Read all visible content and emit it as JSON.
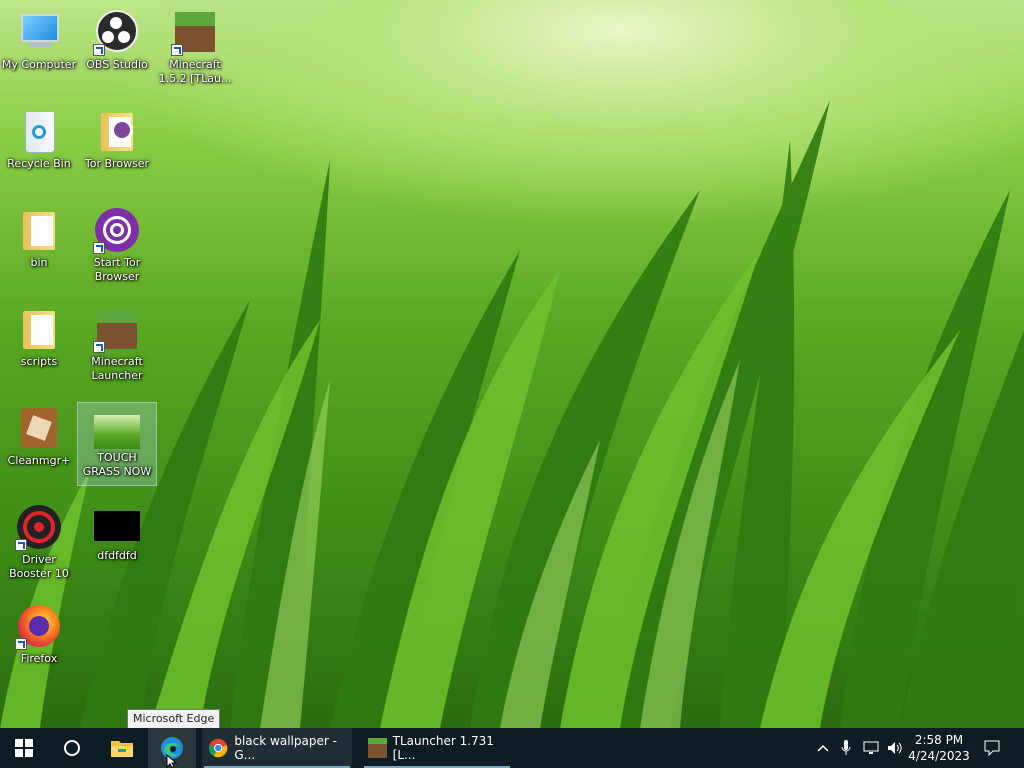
{
  "desktop": {
    "icons": [
      {
        "label": "My Computer",
        "icon": "computer-icon"
      },
      {
        "label": "OBS Studio",
        "icon": "obs-icon"
      },
      {
        "label": "Minecraft 1.5.2 [TLau...",
        "icon": "minecraft-icon"
      },
      {
        "label": "Recycle Bin",
        "icon": "recycle-bin-icon"
      },
      {
        "label": "Tor Browser",
        "icon": "folder-tor-icon"
      },
      {
        "label": "bin",
        "icon": "folder-icon"
      },
      {
        "label": "Start Tor Browser",
        "icon": "tor-icon"
      },
      {
        "label": "scripts",
        "icon": "folder-icon"
      },
      {
        "label": "Minecraft Launcher",
        "icon": "minecraft-icon"
      },
      {
        "label": "Cleanmgr+",
        "icon": "cleanmgr-icon"
      },
      {
        "label": "TOUCH GRASS NOW",
        "icon": "grass-image-icon"
      },
      {
        "label": "Driver Booster 10",
        "icon": "driver-booster-icon"
      },
      {
        "label": "dfdfdfd",
        "icon": "black-image-icon"
      },
      {
        "label": "Firefox",
        "icon": "firefox-icon"
      }
    ]
  },
  "tooltip": {
    "text": "Microsoft Edge"
  },
  "taskbar": {
    "start_icon": "windows-start-icon",
    "search_icon": "cortana-circle-icon",
    "pinned": [
      {
        "name": "File Explorer",
        "icon": "file-explorer-icon"
      },
      {
        "name": "Microsoft Edge",
        "icon": "edge-icon"
      }
    ],
    "apps": [
      {
        "label": "black wallpaper - G...",
        "icon": "chrome-icon"
      },
      {
        "label": "TLauncher 1.731 [L...",
        "icon": "minecraft-icon"
      }
    ],
    "tray": {
      "icons": [
        "chevron-up-icon",
        "microphone-icon",
        "network-icon",
        "volume-icon"
      ],
      "time": "2:58 PM",
      "date": "4/24/2023",
      "notification_icon": "notification-icon"
    }
  },
  "colors": {
    "taskbar": "#0d1d24",
    "accent": "#76a9c4"
  }
}
